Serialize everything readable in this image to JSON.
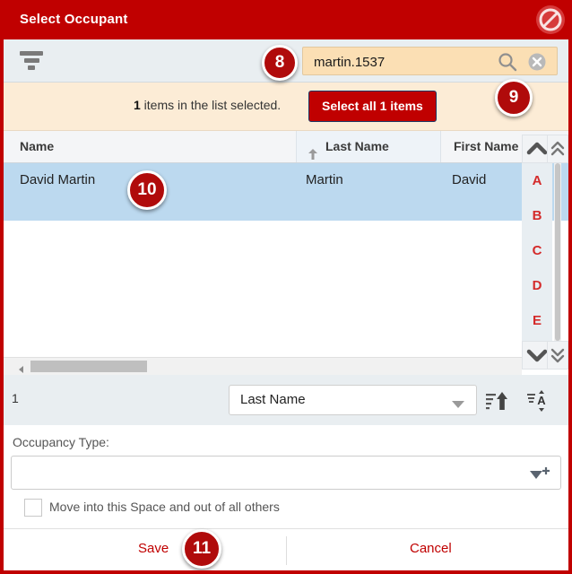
{
  "window": {
    "title": "Select Occupant",
    "close_icon": "no-entry-close-icon"
  },
  "search": {
    "filter_icon": "filter-icon",
    "value": "martin.1537",
    "placeholder": "",
    "search_icon": "magnifier-icon",
    "clear_icon": "clear-circle-x-icon"
  },
  "banner": {
    "count": "1",
    "text": " items in the list selected.",
    "select_all_label": "Select all 1 items"
  },
  "table": {
    "columns": [
      {
        "label": "Name",
        "sorted": false
      },
      {
        "label": "Last Name",
        "sorted": true,
        "sort_dir": "asc"
      },
      {
        "label": "First Name",
        "sorted": false
      }
    ],
    "rows": [
      {
        "name": "David Martin",
        "last_name": "Martin",
        "first_name": "David",
        "selected": true
      }
    ]
  },
  "alphabet_index": {
    "letters": [
      "A",
      "B",
      "C",
      "D",
      "E"
    ],
    "nav_up_icon": "chevron-up-icon",
    "nav_down_icon": "chevron-down-icon",
    "page_up_icon": "double-chevron-up-icon",
    "page_down_icon": "double-chevron-down-icon",
    "letter_color": "#d42a2a"
  },
  "grid_footer": {
    "row_count": "1",
    "sort_field_value": "Last Name",
    "sort_icon_1": "sort-ascending-icon",
    "sort_icon_2": "sort-alphabetical-icon"
  },
  "occupancy": {
    "label": "Occupancy Type:",
    "value": "",
    "dropdown_icon": "dropdown-add-icon"
  },
  "checkbox": {
    "label": "Move into this Space and out of all others",
    "checked": false
  },
  "footer": {
    "save_label": "Save",
    "cancel_label": "Cancel"
  },
  "callouts": [
    {
      "number": "8"
    },
    {
      "number": "9"
    },
    {
      "number": "10"
    },
    {
      "number": "11"
    }
  ],
  "colors": {
    "brand_red": "#c00000",
    "badge_red": "#b00b0b",
    "search_bg": "#fbdfb4",
    "banner_bg": "#fcecd6",
    "row_selected": "#bcd9ef"
  }
}
